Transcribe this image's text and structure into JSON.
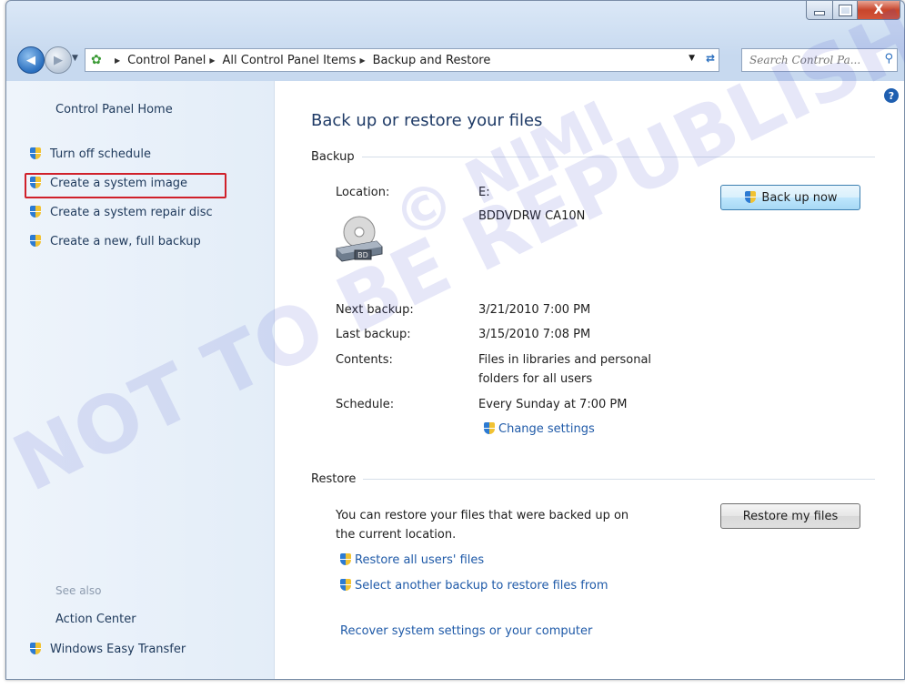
{
  "window": {
    "controls": {
      "minimize": "–",
      "maximize": "□",
      "close": "X"
    }
  },
  "address_bar": {
    "breadcrumbs": [
      "Control Panel",
      "All Control Panel Items",
      "Backup and Restore"
    ],
    "search_placeholder": "Search Control Pa..."
  },
  "left_pane": {
    "home_link": "Control Panel Home",
    "tasks": [
      "Turn off schedule",
      "Create a system image",
      "Create a system repair disc",
      "Create a new, full backup"
    ],
    "see_also_title": "See also",
    "see_also": [
      "Action Center",
      "Windows Easy Transfer"
    ]
  },
  "main": {
    "title": "Back up or restore your files",
    "backup": {
      "section_title": "Backup",
      "location_label": "Location:",
      "location_drive": "E:",
      "location_name": "BDDVDRW CA10N",
      "drive_icon_label": "BD",
      "back_up_now": "Back up now",
      "next_backup_label": "Next backup:",
      "next_backup_value": "3/21/2010 7:00 PM",
      "last_backup_label": "Last backup:",
      "last_backup_value": "3/15/2010 7:08 PM",
      "contents_label": "Contents:",
      "contents_value_line1": "Files in libraries and personal",
      "contents_value_line2": "folders for all users",
      "schedule_label": "Schedule:",
      "schedule_value": "Every Sunday at 7:00 PM",
      "change_settings": "Change settings"
    },
    "restore": {
      "section_title": "Restore",
      "description_line1": "You can restore your files that were backed up on",
      "description_line2": "the current location.",
      "restore_my_files": "Restore my files",
      "restore_all_users": "Restore all users' files",
      "select_another": "Select another backup to restore files from",
      "recover_system": "Recover system settings or your computer"
    },
    "help": "?"
  },
  "watermark": {
    "line1": "© NIMI",
    "line2": "NOT TO BE REPUBLISHED"
  }
}
